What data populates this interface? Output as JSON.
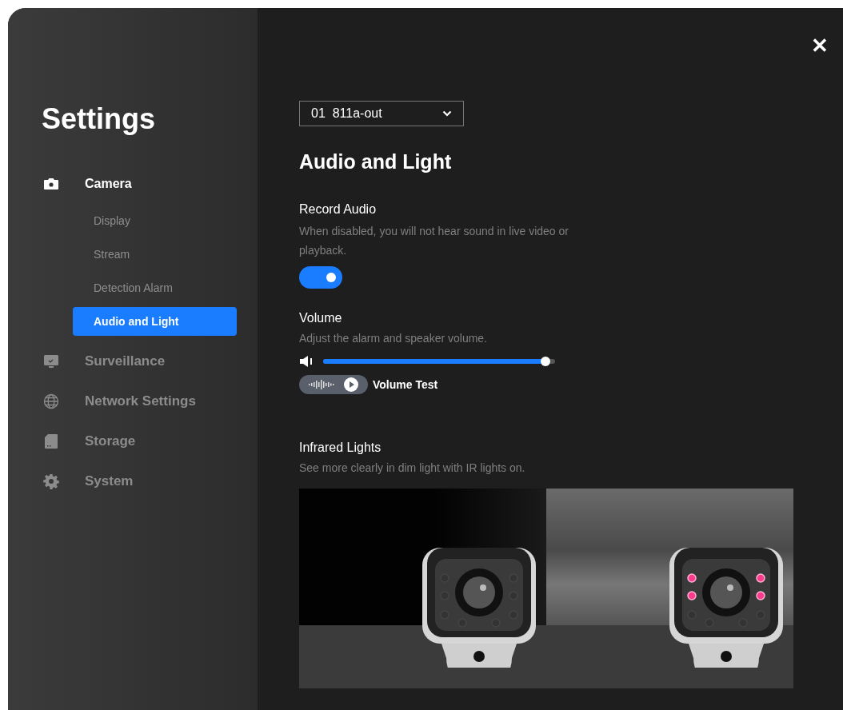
{
  "sidebar": {
    "title": "Settings",
    "sections": [
      {
        "label": "Camera",
        "expanded": true,
        "children": [
          {
            "label": "Display",
            "selected": false
          },
          {
            "label": "Stream",
            "selected": false
          },
          {
            "label": "Detection Alarm",
            "selected": false
          },
          {
            "label": "Audio and Light",
            "selected": true
          }
        ]
      },
      {
        "label": "Surveillance",
        "expanded": false
      },
      {
        "label": "Network Settings",
        "expanded": false
      },
      {
        "label": "Storage",
        "expanded": false
      },
      {
        "label": "System",
        "expanded": false
      }
    ]
  },
  "close": "✕",
  "device_select": {
    "value": "01  811a-out"
  },
  "heading": "Audio and Light",
  "record_audio": {
    "label": "Record Audio",
    "description": "When disabled, you will not hear sound in live video or playback.",
    "on": true
  },
  "volume": {
    "label": "Volume",
    "description": "Adjust the alarm and speaker volume.",
    "level": 0.96,
    "test_label": "Volume Test"
  },
  "infrared": {
    "label": "Infrared Lights",
    "description": "See more clearly in dim light with IR lights on.",
    "panels": [
      {
        "lights_on": false
      },
      {
        "lights_on": true
      }
    ]
  }
}
